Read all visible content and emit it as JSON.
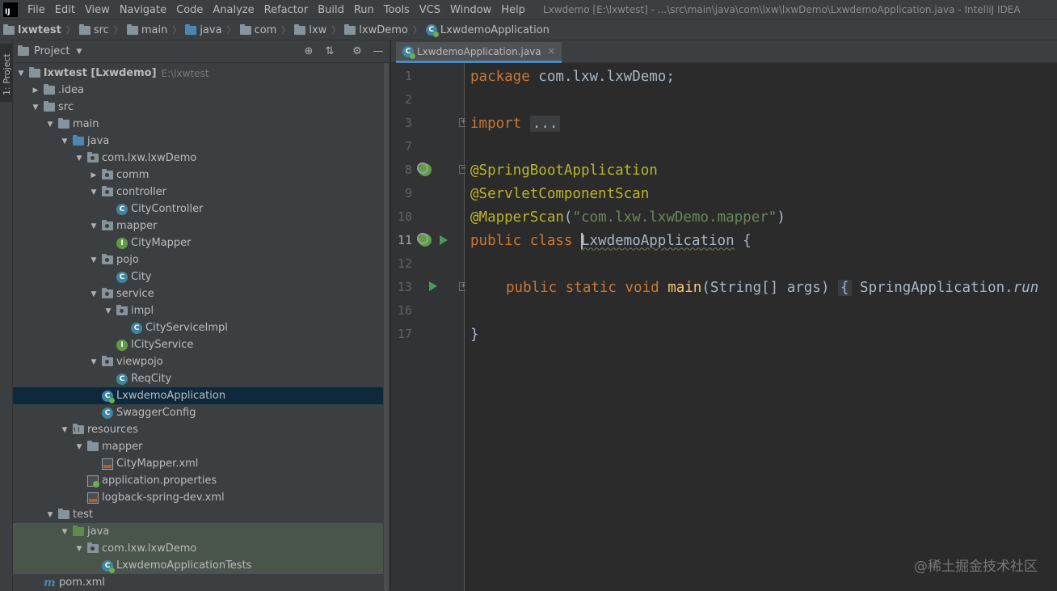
{
  "menubar": {
    "items": [
      "File",
      "Edit",
      "View",
      "Navigate",
      "Code",
      "Analyze",
      "Refactor",
      "Build",
      "Run",
      "Tools",
      "VCS",
      "Window",
      "Help"
    ],
    "window_title": "Lxwdemo [E:\\lxwtest] - ...\\src\\main\\java\\com\\lxw\\lxwDemo\\LxwdemoApplication.java - IntelliJ IDEA"
  },
  "breadcrumb": {
    "items": [
      "lxwtest",
      "src",
      "main",
      "java",
      "com",
      "lxw",
      "lxwDemo",
      "LxwdemoApplication"
    ]
  },
  "tool_stripe": {
    "project_tab": "1: Project"
  },
  "project_panel": {
    "title": "Project",
    "tree": [
      {
        "label": "lxwtest [Lxwdemo]",
        "hint": "E:\\lxwtest"
      },
      {
        "label": ".idea"
      },
      {
        "label": "src"
      },
      {
        "label": "main"
      },
      {
        "label": "java"
      },
      {
        "label": "com.lxw.lxwDemo"
      },
      {
        "label": "comm"
      },
      {
        "label": "controller"
      },
      {
        "label": "CityController"
      },
      {
        "label": "mapper"
      },
      {
        "label": "CityMapper"
      },
      {
        "label": "pojo"
      },
      {
        "label": "City"
      },
      {
        "label": "service"
      },
      {
        "label": "impl"
      },
      {
        "label": "CityServiceImpl"
      },
      {
        "label": "ICityService"
      },
      {
        "label": "viewpojo"
      },
      {
        "label": "ReqCity"
      },
      {
        "label": "LxwdemoApplication"
      },
      {
        "label": "SwaggerConfig"
      },
      {
        "label": "resources"
      },
      {
        "label": "mapper"
      },
      {
        "label": "CityMapper.xml"
      },
      {
        "label": "application.properties"
      },
      {
        "label": "logback-spring-dev.xml"
      },
      {
        "label": "test"
      },
      {
        "label": "java"
      },
      {
        "label": "com.lxw.lxwDemo"
      },
      {
        "label": "LxwdemoApplicationTests"
      },
      {
        "label": "pom.xml"
      }
    ]
  },
  "editor": {
    "tab_label": "LxwdemoApplication.java",
    "line_numbers": [
      "1",
      "2",
      "3",
      "7",
      "8",
      "9",
      "10",
      "11",
      "12",
      "13",
      "16",
      "17"
    ],
    "code": {
      "l1_kw": "package",
      "l1_rest": " com.lxw.lxwDemo;",
      "l3_kw": "import",
      "l3_fold": "...",
      "l8": "@SpringBootApplication",
      "l9": "@ServletComponentScan",
      "l10_ann": "@MapperScan",
      "l10_str": "\"com.lxw.lxwDemo.mapper\"",
      "l11_kw": "public class",
      "l11_name": "LxwdemoApplication",
      "l11_rest": " {",
      "l13_kw": "public static void",
      "l13_fn": "main",
      "l13_args": "(String[] args)",
      "l13_fold": "{",
      "l13_call": "SpringApplication.",
      "l13_run": "run",
      "l17": "}"
    }
  },
  "watermark": "@稀土掘金技术社区"
}
